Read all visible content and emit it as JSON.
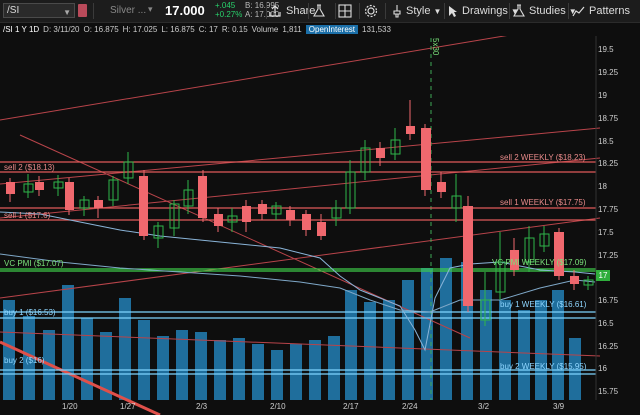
{
  "toolbar": {
    "symbol": "/SI",
    "security_name": "Silver ...",
    "last_price": "17.000",
    "change": "+.045",
    "change_pct": "+0.27%",
    "bid": "B: 16.995",
    "ask": "A: 17.000",
    "share_label": "Share",
    "style_label": "Style",
    "drawings_label": "Drawings",
    "studies_label": "Studies",
    "patterns_label": "Patterns"
  },
  "infobar": {
    "symbol_period": "/SI 1 Y 1D",
    "date": "D: 3/11/20",
    "open": "O: 16.875",
    "high": "H: 17.025",
    "low": "L: 16.875",
    "close": "C: 17",
    "range": "R: 0.15",
    "volume_label": "Volume",
    "volume": "1,811",
    "oi_label": "OpenInterest",
    "oi_value": "131,533"
  },
  "levels": {
    "sell2": "sell 2 ($18.13)",
    "sell1": "sell 1 ($17.6)",
    "vc_pmi": "VC PMI ($17.07)",
    "buy1": "buy 1 ($16.53)",
    "buy2": "buy 2 ($16)",
    "sell2_weekly": "sell 2 WEEKLY ($18.23)",
    "sell1_weekly": "sell 1 WEEKLY ($17.75)",
    "vc_pmi_weekly": "VC PMI WEEKLY ($17.09)",
    "buy1_weekly": "buy 1 WEEKLY ($16.61)",
    "buy2_weekly": "buy 2 WEEKLY ($15.95)"
  },
  "chart_marker": "5x30",
  "current_price_tag": "17",
  "y_ticks": [
    "19.5",
    "19.25",
    "19",
    "18.75",
    "18.5",
    "18.25",
    "18",
    "17.75",
    "17.5",
    "17.25",
    "16.75",
    "16.5",
    "16.25",
    "16",
    "15.75"
  ],
  "x_ticks": [
    "1/20",
    "1/27",
    "2/3",
    "2/10",
    "2/17",
    "2/24",
    "3/2",
    "3/9"
  ],
  "colors": {
    "up": "#2fb54a",
    "down": "#f0686e",
    "level_red": "#e05a5a",
    "level_green": "#3fcf4a",
    "level_blue": "#7fd4ff",
    "volume": "#1f6e9c"
  }
}
